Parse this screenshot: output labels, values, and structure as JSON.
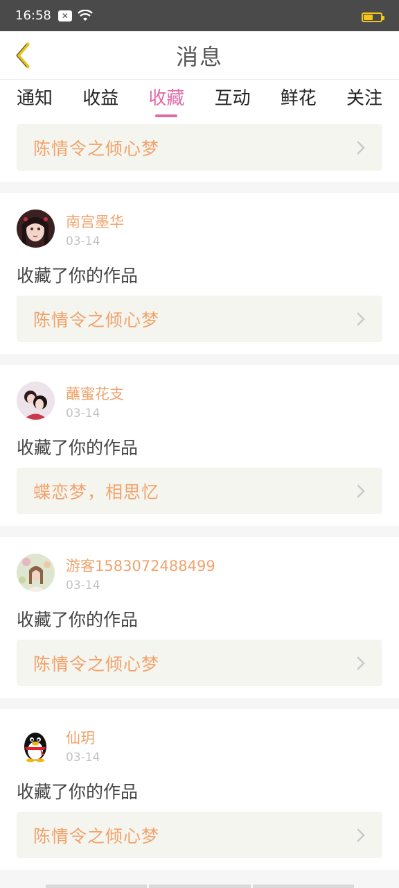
{
  "status_bar": {
    "time": "16:58",
    "notification_icon": "x-box-icon",
    "wifi_icon": "wifi-icon",
    "battery_icon": "battery-icon",
    "battery_color": "#f5c518"
  },
  "nav": {
    "title": "消息",
    "back_icon": "chevron-left-icon",
    "back_color": "#e6c21a"
  },
  "tabs": [
    {
      "label": "通知",
      "active": false
    },
    {
      "label": "收益",
      "active": false
    },
    {
      "label": "收藏",
      "active": true
    },
    {
      "label": "互动",
      "active": false
    },
    {
      "label": "鲜花",
      "active": false
    },
    {
      "label": "关注",
      "active": false
    }
  ],
  "colors": {
    "accent": "#e06aa4",
    "username": "#f1a36c",
    "work_title": "#f1a36c",
    "card_bg": "#f5f5ef"
  },
  "partial_card": {
    "work_title": "陈情令之倾心梦"
  },
  "messages": [
    {
      "username": "南宫墨华",
      "date": "03-14",
      "action": "收藏了你的作品",
      "work_title": "陈情令之倾心梦",
      "avatar": "girl-portrait-avatar"
    },
    {
      "username": "蘸蜜花支",
      "date": "03-14",
      "action": "收藏了你的作品",
      "work_title": "蝶恋梦，相思忆",
      "avatar": "couple-avatar"
    },
    {
      "username": "游客1583072488499",
      "date": "03-14",
      "action": "收藏了你的作品",
      "work_title": "陈情令之倾心梦",
      "avatar": "flower-girl-avatar"
    },
    {
      "username": "仙玥",
      "date": "03-14",
      "action": "收藏了你的作品",
      "work_title": "陈情令之倾心梦",
      "avatar": "qq-penguin-avatar"
    }
  ]
}
